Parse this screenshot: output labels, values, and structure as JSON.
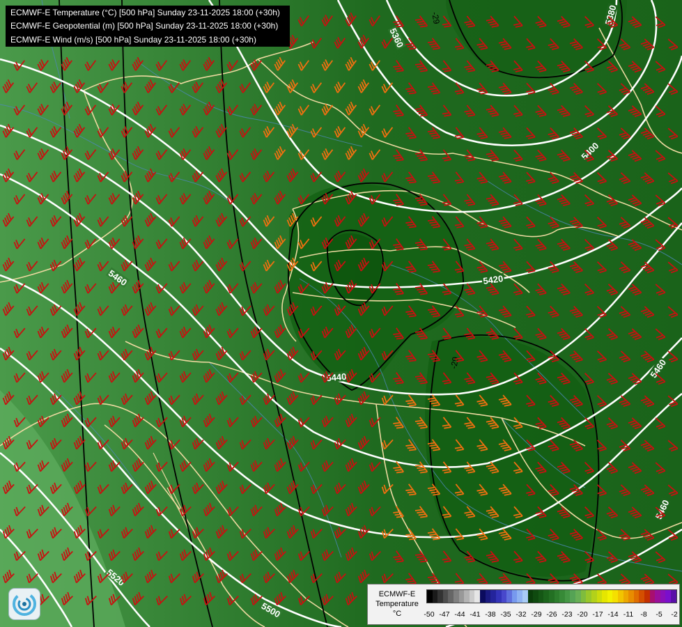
{
  "titles": [
    "ECMWF-E Temperature (°C) [500 hPa] Sunday 23-11-2025 18:00 (+30h)",
    "ECMWF-E Geopotential (m) [500 hPa] Sunday 23-11-2025 18:00 (+30h)",
    "ECMWF-E Wind (m/s) [500 hPa] Sunday 23-11-2025 18:00 (+30h)"
  ],
  "contour_labels": [
    "5360",
    "5380",
    "5400",
    "5420",
    "5440",
    "5460",
    "5460",
    "5460",
    "5520",
    "5500",
    "-29",
    "-29"
  ],
  "legend": {
    "title_line1": "ECMWF-E",
    "title_line2": "Temperature",
    "unit": "°C",
    "ticks": [
      "-50",
      "-47",
      "-44",
      "-41",
      "-38",
      "-35",
      "-32",
      "-29",
      "-26",
      "-23",
      "-20",
      "-17",
      "-14",
      "-11",
      "-8",
      "-5",
      "-2"
    ],
    "colors": [
      "#000000",
      "#1a1a1a",
      "#333333",
      "#4d4d4d",
      "#666666",
      "#808080",
      "#999999",
      "#b3b3b3",
      "#cccccc",
      "#e6e6e6",
      "#0b0b5e",
      "#1a1a80",
      "#24249c",
      "#3333b8",
      "#4848cc",
      "#5f6fdd",
      "#7799ee",
      "#8fb3f2",
      "#a8ccf5",
      "#0a3d0a",
      "#0f4a0f",
      "#155715",
      "#1b641b",
      "#237023",
      "#2c7d2c",
      "#378a37",
      "#449744",
      "#55a355",
      "#67af55",
      "#7fbc3d",
      "#99c72a",
      "#b3d11a",
      "#ccdc0c",
      "#e5e600",
      "#f2f200",
      "#f5e000",
      "#f2c400",
      "#eda800",
      "#e88c00",
      "#e06e00",
      "#d44f00",
      "#c43000",
      "#a80f6f",
      "#9a0f9a",
      "#8a0fb8",
      "#7a0fcc",
      "#5a0fa8"
    ]
  },
  "colors": {
    "background": "#2f7a2f",
    "coast": "#ecd9a0",
    "rivers": "#4d88b8",
    "isohypse": "#ffffff",
    "isotherm": "#000000",
    "barb_strong": "#c81010",
    "barb_weak": "#f07010"
  }
}
